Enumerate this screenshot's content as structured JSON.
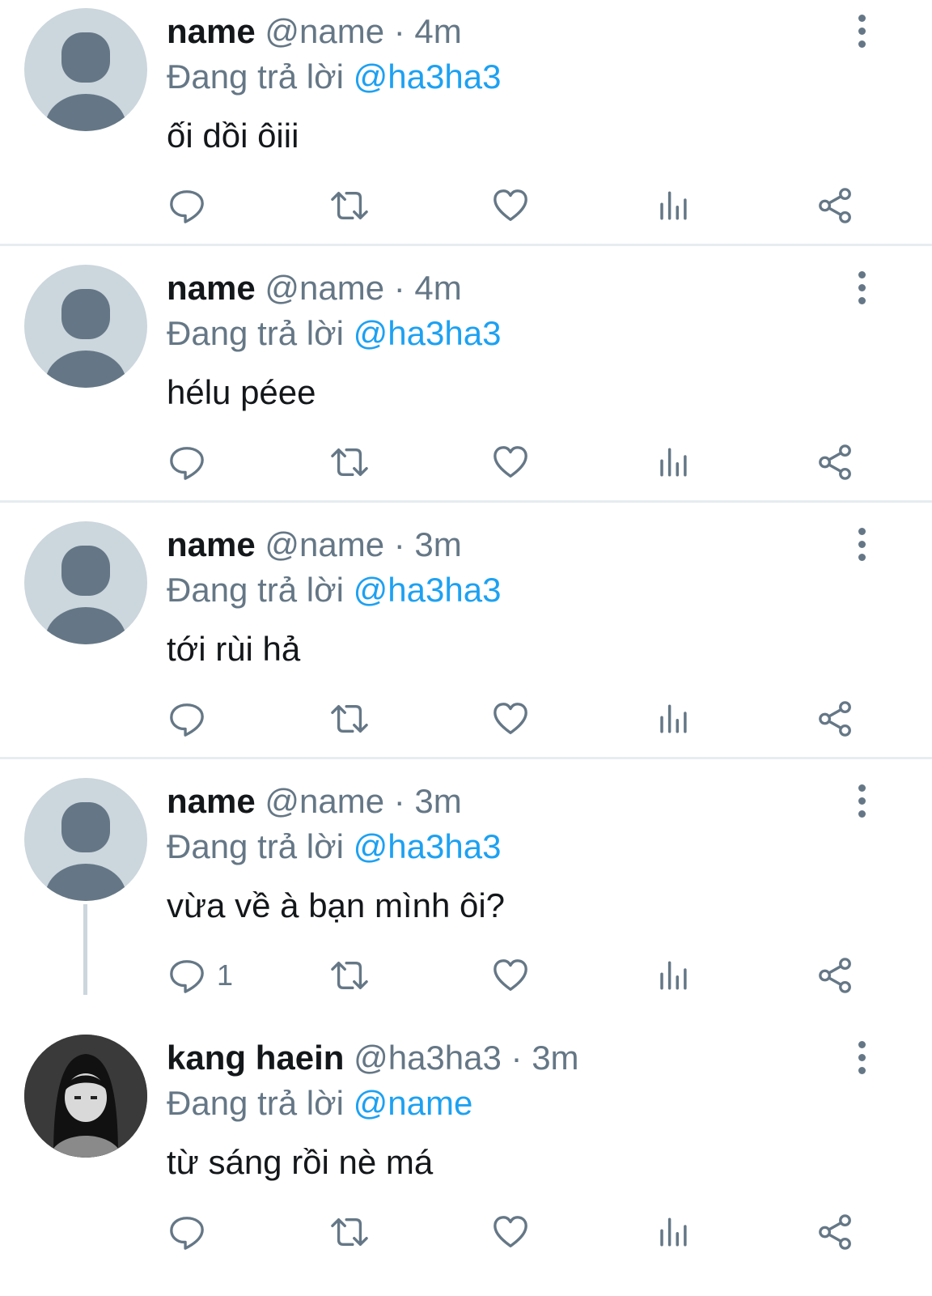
{
  "colors": {
    "accent": "#1da1f2",
    "secondary": "#657786",
    "text": "#14171a",
    "divider": "#e6ecf0"
  },
  "tweets": [
    {
      "name": "name",
      "meta": "@name · 4m",
      "reply_prefix": "Đang trả lời",
      "reply_to": "@ha3ha3",
      "text": "ối dồi ôiii",
      "reply_count": ""
    },
    {
      "name": "name",
      "meta": "@name · 4m",
      "reply_prefix": "Đang trả lời",
      "reply_to": "@ha3ha3",
      "text": "hélu péee",
      "reply_count": ""
    },
    {
      "name": "name",
      "meta": "@name · 3m",
      "reply_prefix": "Đang trả lời",
      "reply_to": "@ha3ha3",
      "text": "tới rùi hả",
      "reply_count": ""
    },
    {
      "name": "name",
      "meta": "@name · 3m",
      "reply_prefix": "Đang trả lời",
      "reply_to": "@ha3ha3",
      "text": "vừa về à bạn mình ôi?",
      "reply_count": "1"
    },
    {
      "name": "kang haein",
      "meta": "@ha3ha3 · 3m",
      "reply_prefix": "Đang trả lời",
      "reply_to": "@name",
      "text": "từ sáng rồi nè má",
      "reply_count": ""
    }
  ],
  "icons": [
    "reply-icon",
    "retweet-icon",
    "like-icon",
    "analytics-icon",
    "share-icon",
    "more-options-icon"
  ]
}
